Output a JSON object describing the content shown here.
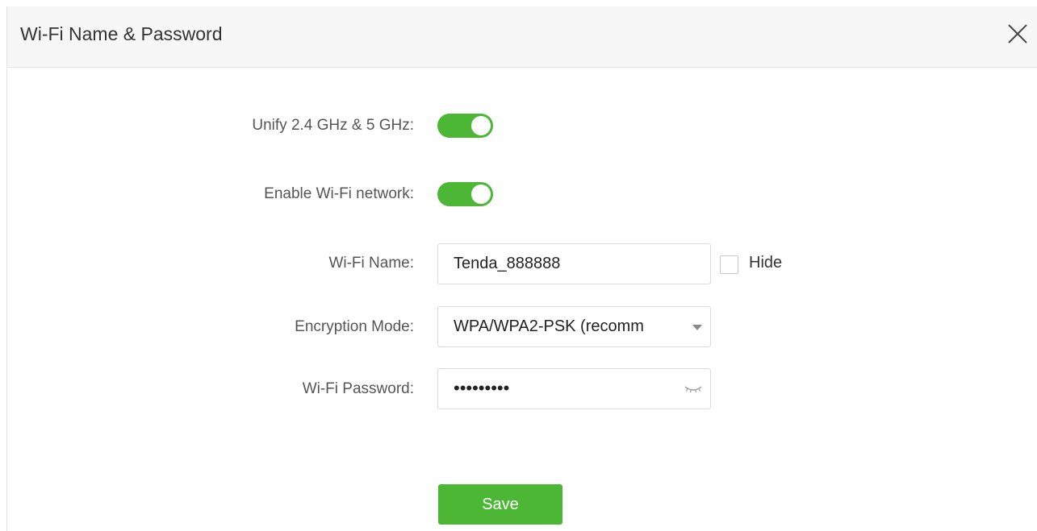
{
  "dialog": {
    "title": "Wi-Fi Name & Password",
    "close_icon": "close-icon"
  },
  "form": {
    "unify_bands": {
      "label": "Unify 2.4 GHz & 5 GHz:",
      "enabled": true
    },
    "enable_wifi": {
      "label": "Enable Wi-Fi network:",
      "enabled": true
    },
    "wifi_name": {
      "label": "Wi-Fi Name:",
      "value": "Tenda_888888",
      "hide_label": "Hide",
      "hide_checked": false
    },
    "encryption_mode": {
      "label": "Encryption Mode:",
      "selected": "WPA/WPA2-PSK (recomm"
    },
    "wifi_password": {
      "label": "Wi-Fi Password:",
      "masked_value": "•••••••••",
      "eye_icon": "eye-closed-icon"
    },
    "save_label": "Save"
  },
  "colors": {
    "toggle_on": "#4cb635",
    "save_button": "#4cb635",
    "header_bg": "#f7f7f7"
  }
}
